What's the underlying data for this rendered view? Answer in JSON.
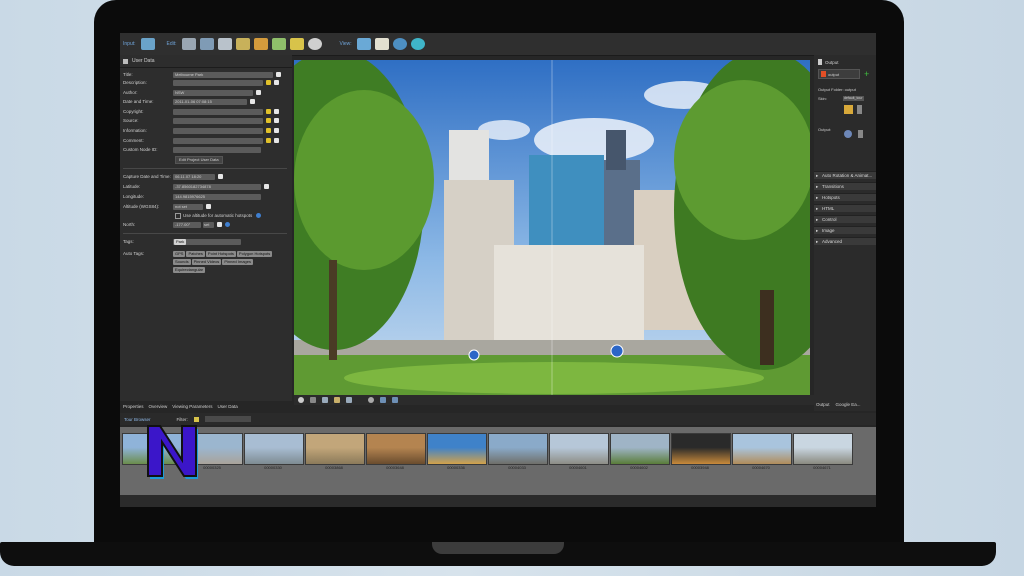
{
  "toolbar": {
    "input_label": "Input:",
    "edit_label": "Edit:",
    "view_label": "View:",
    "input_icons": [
      "panorama-input-icon"
    ],
    "edit_icons": [
      "film-strip-icon",
      "image-panel-icon",
      "picture-frame-icon",
      "blocks-icon",
      "cube-icon",
      "hierarchy-icon",
      "map-icon",
      "reel-icon"
    ],
    "view_icons": [
      "binoculars-icon",
      "clipboard-icon",
      "globe-icon",
      "eye-icon"
    ]
  },
  "left_panel": {
    "title": "User Data",
    "fields": {
      "title": {
        "label": "Title:",
        "value": "Melbourne Park"
      },
      "description": {
        "label": "Description:",
        "value": ""
      },
      "author": {
        "label": "Author:",
        "value": "NSW"
      },
      "datetime": {
        "label": "Date and Time:",
        "value": "2011-01-06 07:08:15"
      },
      "copyright": {
        "label": "Copyright:",
        "value": ""
      },
      "source": {
        "label": "Source:",
        "value": ""
      },
      "information": {
        "label": "Information:",
        "value": ""
      },
      "comment": {
        "label": "Comment:",
        "value": ""
      },
      "custom_node_id": {
        "label": "Custom Node ID:",
        "value": ""
      }
    },
    "edit_project_button": "Edit Project User Data",
    "capture": {
      "label": "Capture Date and Time:",
      "value": "06.11.07 18:20",
      "latitude_label": "Latitude:",
      "latitude_value": "-37.8560182734878",
      "longitude_label": "Longitude:",
      "longitude_value": "144.9815976625",
      "altitude_label": "Altitude (WGS84):",
      "altitude_value": "not set",
      "use_altitude_label": "Use altitude for automatic hotspots",
      "north_label": "North:",
      "north_value": "-177.00°",
      "north_unit": "set"
    },
    "tags_label": "Tags:",
    "tag_value": "Park",
    "auto_tags_label": "Auto Tags:",
    "auto_tags": [
      "GPS",
      "Patches",
      "Point Hotspots",
      "Polygon Hotspots",
      "Sounds",
      "Pinned Videos",
      "Pinned Images",
      "Equirectangular"
    ]
  },
  "bottom_tabs": [
    "Properties",
    "Overview",
    "Viewing Parameters",
    "User Data"
  ],
  "right_panel": {
    "output_title": "Output",
    "output_select": "output",
    "output_folder_label": "Output Folder: output",
    "skin_label": "Skin:",
    "skin_value": "default_tour",
    "output_label": "Output:",
    "sections": [
      "Auto Rotation & Animat...",
      "Transitions",
      "Hotspots",
      "HTML",
      "Control",
      "Image",
      "Advanced"
    ]
  },
  "status_tabs": [
    "Output",
    "Google Ea..."
  ],
  "tour_browser": {
    "title": "Tour Browser",
    "filter_label": "Filter:",
    "thumbs": [
      "",
      "00000325",
      "00000330",
      "00003868",
      "00003648",
      "00000336",
      "00004033",
      "00004601",
      "00004602",
      "00003948",
      "00004670",
      "00004671"
    ]
  },
  "colors": {
    "toolbar_label": "#6fa3d8",
    "panel_bg": "#2d2d2d",
    "logo_purple": "#3b16c9",
    "logo_blue": "#1c9bd8"
  }
}
